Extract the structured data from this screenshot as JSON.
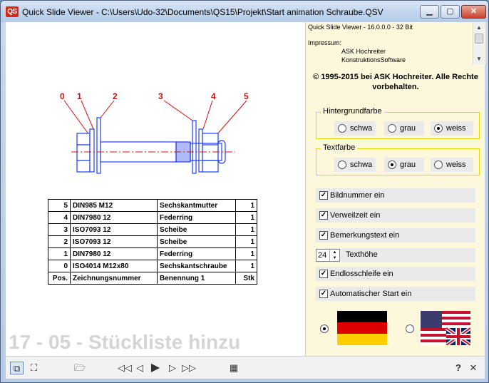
{
  "window": {
    "app_icon_text": "QS",
    "title": "Quick Slide Viewer - C:\\Users\\Udo-32\\Documents\\QS15\\Projekt\\Start animation Schraube.QSV",
    "min_symbol": "▁",
    "max_symbol": "▢",
    "close_symbol": "✕"
  },
  "slide": {
    "title": "17 - 05 - Stückliste hinzu",
    "callouts": [
      "0",
      "1",
      "2",
      "3",
      "4",
      "5"
    ],
    "table": {
      "rows": [
        [
          "5",
          "DIN985 M12",
          "Sechskantmutter",
          "1"
        ],
        [
          "4",
          "DIN7980 12",
          "Federring",
          "1"
        ],
        [
          "3",
          "ISO7093 12",
          "Scheibe",
          "1"
        ],
        [
          "2",
          "ISO7093 12",
          "Scheibe",
          "1"
        ],
        [
          "1",
          "DIN7980 12",
          "Federring",
          "1"
        ],
        [
          "0",
          "ISO4014 M12x80",
          "Sechskantschraube",
          "1"
        ]
      ],
      "header": [
        "Pos.",
        "Zeichnungsnummer",
        "Benennung 1",
        "Stk"
      ]
    }
  },
  "info": {
    "version": "Quick Slide Viewer  -  16.0.0.0  -  32 Bit",
    "impressum_label": "Impressum:",
    "company_1": "ASK Hochreiter",
    "company_2": "KonstruktionsSoftware",
    "copyright": "© 1995-2015 bei ASK Hochreiter. Alle Rechte vorbehalten."
  },
  "background_color": {
    "label": "Hintergrundfarbe",
    "options": [
      "schwa",
      "grau",
      "weiss"
    ],
    "selected": "weiss"
  },
  "text_color": {
    "label": "Textfarbe",
    "options": [
      "schwa",
      "grau",
      "weiss"
    ],
    "selected": "grau"
  },
  "options": {
    "image_number": "Bildnummer ein",
    "dwell_time": "Verweilzeit ein",
    "comment_text": "Bemerkungstext ein",
    "text_height_value": "24",
    "text_height_label": "Texthöhe",
    "loop": "Endlosschleife ein",
    "autostart": "Automatischer Start ein"
  },
  "language": {
    "selected": "german"
  },
  "toolbar": {
    "first": "◁◁",
    "prev": "◁",
    "play": "▶",
    "next": "▷",
    "last": "▷▷",
    "help": "?"
  },
  "colors": {
    "accent_red": "#d52a1a",
    "group_border": "#e6d800",
    "panel_bg": "#fdf7dc",
    "bolt_blue": "#1f3cf0"
  }
}
